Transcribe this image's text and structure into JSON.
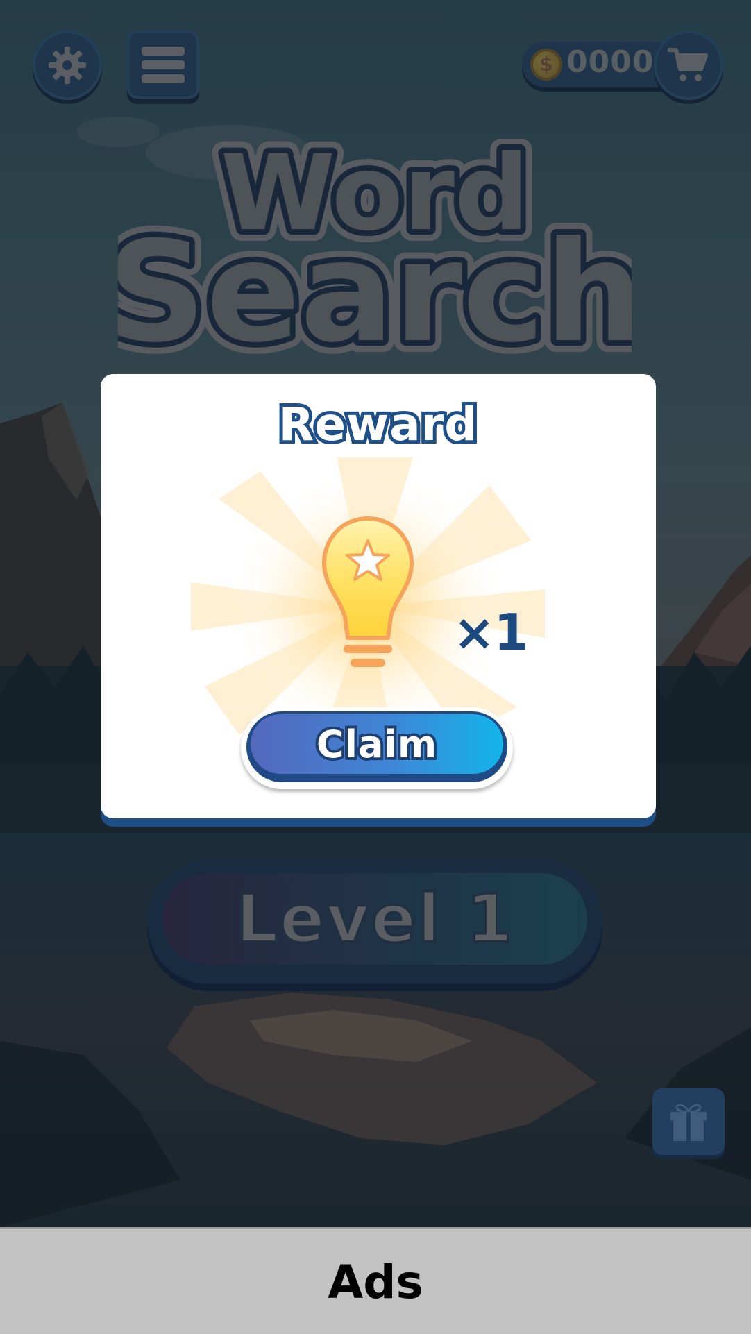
{
  "topbar": {
    "settings_icon": "gear-icon",
    "menu_icon": "hamburger-menu-icon",
    "coin_symbol": "$",
    "coins": "0000",
    "shop_icon": "shopping-cart-icon"
  },
  "title": {
    "line1": "Word",
    "line2": "Search"
  },
  "reward_dialog": {
    "title": "Reward",
    "item_icon": "lightbulb-star-icon",
    "quantity_label": "×1",
    "claim_label": "Claim"
  },
  "level_button": {
    "label": "Level 1"
  },
  "gift_icon": "gift-icon",
  "ads": {
    "label": "Ads"
  },
  "colors": {
    "dialog_border": "#1d4f86",
    "claim_gradient_start": "#5468bb",
    "claim_gradient_end": "#13b4ea",
    "bulb_fill": "#ffd84a",
    "bulb_outline": "#f5a45a",
    "ads_bar": "#c3c3c3"
  }
}
